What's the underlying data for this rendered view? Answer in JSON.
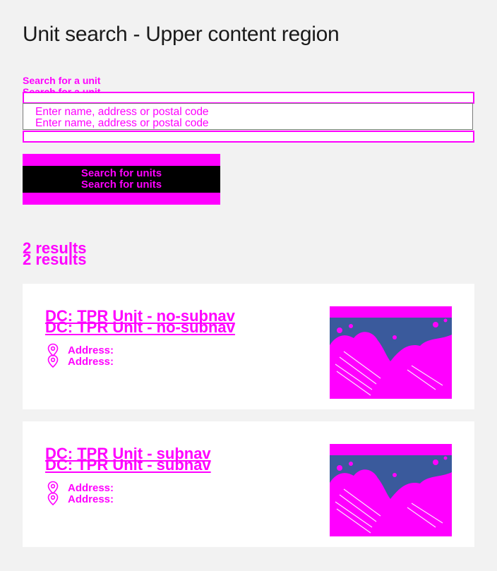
{
  "page": {
    "title": "Unit search - Upper content region"
  },
  "search": {
    "label": "Search for a unit",
    "placeholder": "Enter name, address or postal code",
    "button_label": "Search for units"
  },
  "results": {
    "count_label": "2 results",
    "items": [
      {
        "title": "DC: TPR Unit - no-subnav",
        "address_label": "Address:"
      },
      {
        "title": "DC: TPR Unit - subnav",
        "address_label": "Address:"
      }
    ]
  },
  "colors": {
    "background": "#f2f2f2",
    "debug_magenta": "#ff00ff",
    "button_inner": "#000000",
    "card": "#ffffff",
    "image_sky": "#3a5a9c"
  },
  "icons": {
    "address": "map-pin-icon"
  }
}
